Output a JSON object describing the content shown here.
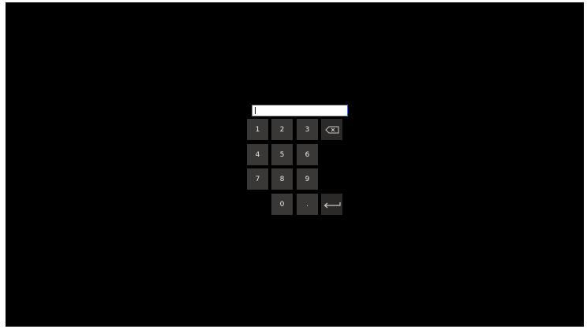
{
  "keypad": {
    "input": {
      "value": "",
      "placeholder": ""
    },
    "keys": {
      "k1": "1",
      "k2": "2",
      "k3": "3",
      "k4": "4",
      "k5": "5",
      "k6": "6",
      "k7": "7",
      "k8": "8",
      "k9": "9",
      "k0": "0",
      "decimal": "."
    },
    "icons": {
      "backspace": "backspace-icon",
      "enter": "enter-icon"
    },
    "colors": {
      "background": "#000000",
      "key": "#3a3837",
      "key_text": "#e8e8e8",
      "input_border": "#3a70c8"
    }
  }
}
